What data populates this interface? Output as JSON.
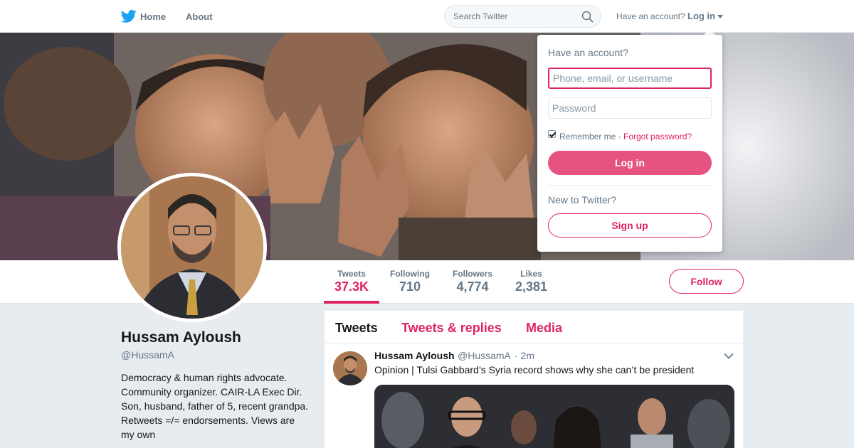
{
  "nav": {
    "home_label": "Home",
    "about_label": "About",
    "search_placeholder": "Search Twitter",
    "have_account": "Have an account?",
    "login_label": "Log in"
  },
  "profile": {
    "name": "Hussam Ayloush",
    "handle": "@HussamA",
    "bio": "Democracy & human rights advocate. Community organizer. CAIR-LA Exec Dir. Son, husband, father of 5, recent grandpa. Retweets =/= endorsements. Views are my own",
    "follow_label": "Follow",
    "stats": [
      {
        "label": "Tweets",
        "value": "37.3K"
      },
      {
        "label": "Following",
        "value": "710"
      },
      {
        "label": "Followers",
        "value": "4,774"
      },
      {
        "label": "Likes",
        "value": "2,381"
      }
    ]
  },
  "timeline": {
    "tabs": [
      "Tweets",
      "Tweets & replies",
      "Media"
    ],
    "tweet": {
      "name": "Hussam Ayloush",
      "handle": "@HussamA",
      "time": "· 2m",
      "text": "Opinion | Tulsi Gabbard’s Syria record shows why she can’t be president"
    }
  },
  "login_dropdown": {
    "title": "Have an account?",
    "username_placeholder": "Phone, email, or username",
    "password_placeholder": "Password",
    "remember_label": "Remember me ·",
    "remember_checked": true,
    "forgot_label": "Forgot password?",
    "login_button": "Log in",
    "new_label": "New to Twitter?",
    "signup_button": "Sign up"
  },
  "colors": {
    "accent": "#e0245e",
    "brand_blue": "#1da1f2",
    "muted_text": "#657786",
    "background": "#e6ecf0"
  },
  "icons": [
    "twitter-bird-icon",
    "search-icon",
    "caret-down-icon",
    "chevron-down-icon",
    "checkbox-icon"
  ]
}
